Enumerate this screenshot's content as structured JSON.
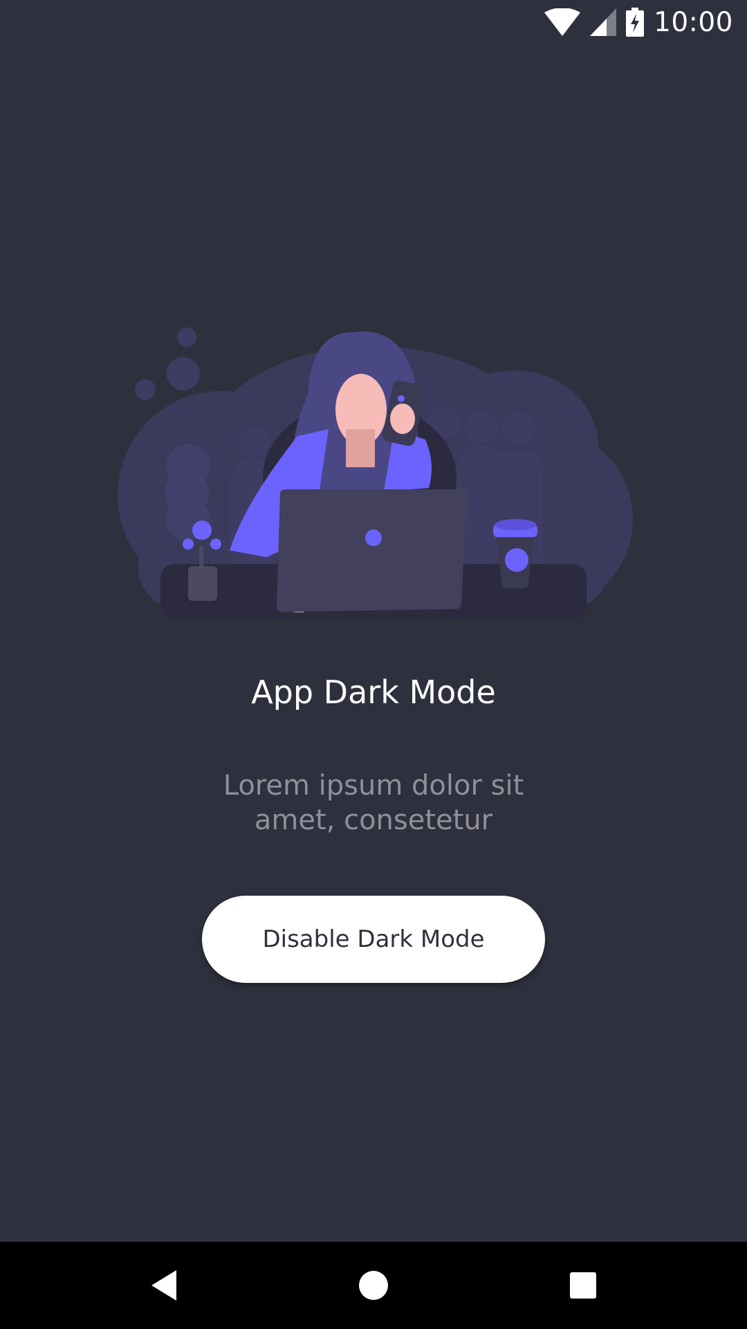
{
  "status_bar": {
    "time": "10:00",
    "icons": [
      "wifi-icon",
      "cell-signal-icon",
      "battery-charging-icon"
    ]
  },
  "illustration": {
    "icon": "woman-with-laptop-and-phone-illustration"
  },
  "content": {
    "title": "App Dark Mode",
    "subtitle": "Lorem ipsum dolor sit amet, consetetur",
    "button_label": "Disable Dark Mode"
  },
  "nav_bar": {
    "icons": [
      "back-icon",
      "home-icon",
      "recents-icon"
    ]
  },
  "colors": {
    "background": "#2e313d",
    "accent": "#6c63ff",
    "title_text": "#ffffff",
    "subtitle_text": "#8f909b",
    "button_bg": "#ffffff",
    "button_text": "#2e313d",
    "nav_bar_bg": "#000000"
  }
}
